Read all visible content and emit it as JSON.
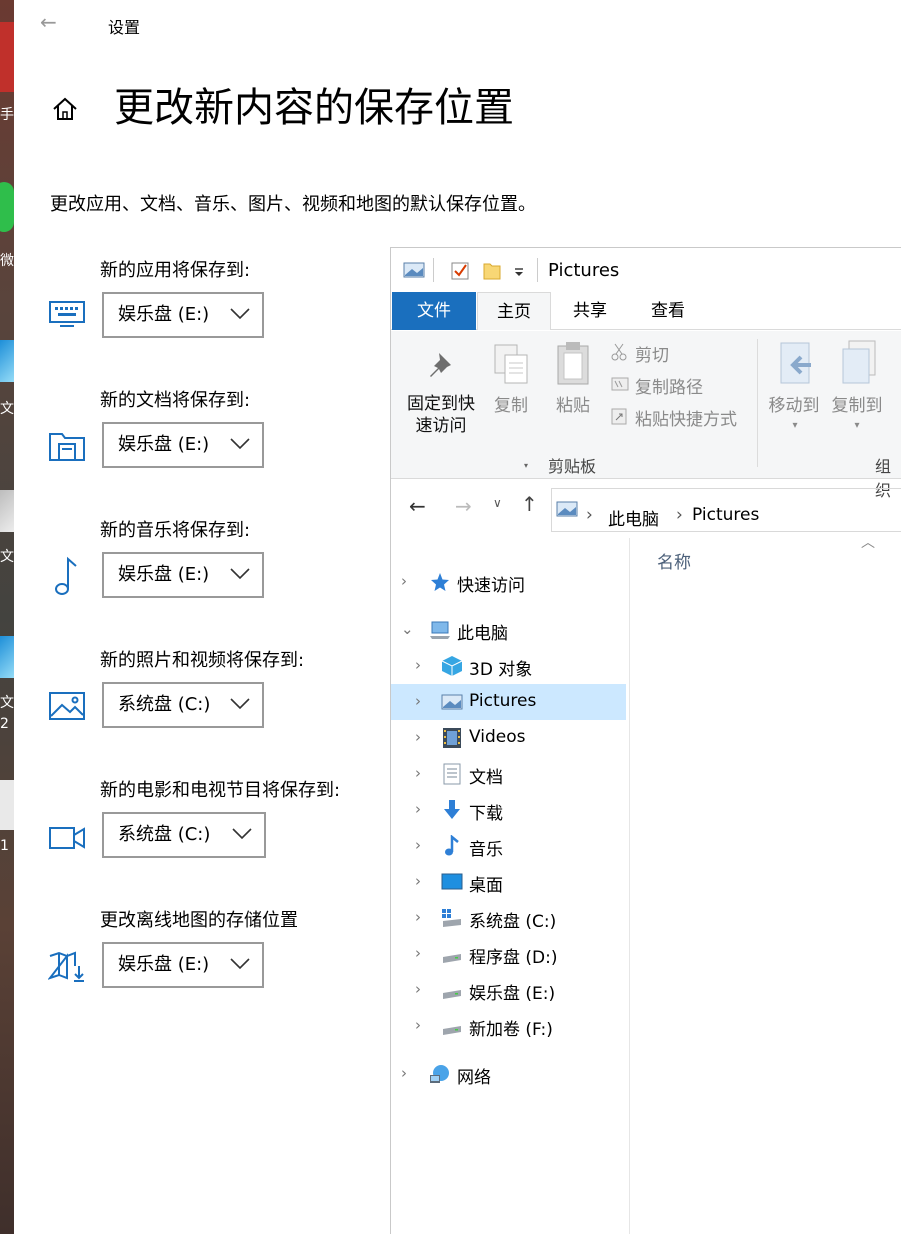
{
  "settings": {
    "window_title": "设置",
    "heading": "更改新内容的保存位置",
    "description": "更改应用、文档、音乐、图片、视频和地图的默认保存位置。",
    "groups": [
      {
        "label": "新的应用将保存到:",
        "value": "娱乐盘 (E:)",
        "icon": "keyboard-icon"
      },
      {
        "label": "新的文档将保存到:",
        "value": "娱乐盘 (E:)",
        "icon": "folder-doc-icon"
      },
      {
        "label": "新的音乐将保存到:",
        "value": "娱乐盘 (E:)",
        "icon": "music-note-icon"
      },
      {
        "label": "新的照片和视频将保存到:",
        "value": "系统盘 (C:)",
        "icon": "picture-icon"
      },
      {
        "label": "新的电影和电视节目将保存到:",
        "value": "系统盘 (C:)",
        "icon": "video-camera-icon"
      },
      {
        "label": "更改离线地图的存储位置",
        "value": "娱乐盘 (E:)",
        "icon": "map-download-icon"
      }
    ]
  },
  "desktop": {
    "labels": [
      "手游",
      "微",
      "文",
      "文",
      "文",
      "2",
      "1"
    ]
  },
  "explorer": {
    "title": "Pictures",
    "tabs": {
      "file": "文件",
      "home": "主页",
      "share": "共享",
      "view": "查看"
    },
    "ribbon": {
      "pin_line1": "固定到快",
      "pin_line2": "速访问",
      "copy": "复制",
      "paste": "粘贴",
      "cut": "剪切",
      "copy_path": "复制路径",
      "paste_shortcut": "粘贴快捷方式",
      "clipboard_group": "剪贴板",
      "move_to": "移动到",
      "copy_to": "复制到",
      "organize_group": "组织"
    },
    "address": {
      "crumb1": "此电脑",
      "crumb2": "Pictures"
    },
    "column_name": "名称",
    "nav": {
      "quick_access": "快速访问",
      "this_pc": "此电脑",
      "items": [
        "3D 对象",
        "Pictures",
        "Videos",
        "文档",
        "下载",
        "音乐",
        "桌面",
        "系统盘 (C:)",
        "程序盘 (D:)",
        "娱乐盘 (E:)",
        "新加卷 (F:)"
      ],
      "network": "网络"
    },
    "colors": {
      "accent": "#1a6fbe",
      "selected": "#cce8ff"
    }
  }
}
